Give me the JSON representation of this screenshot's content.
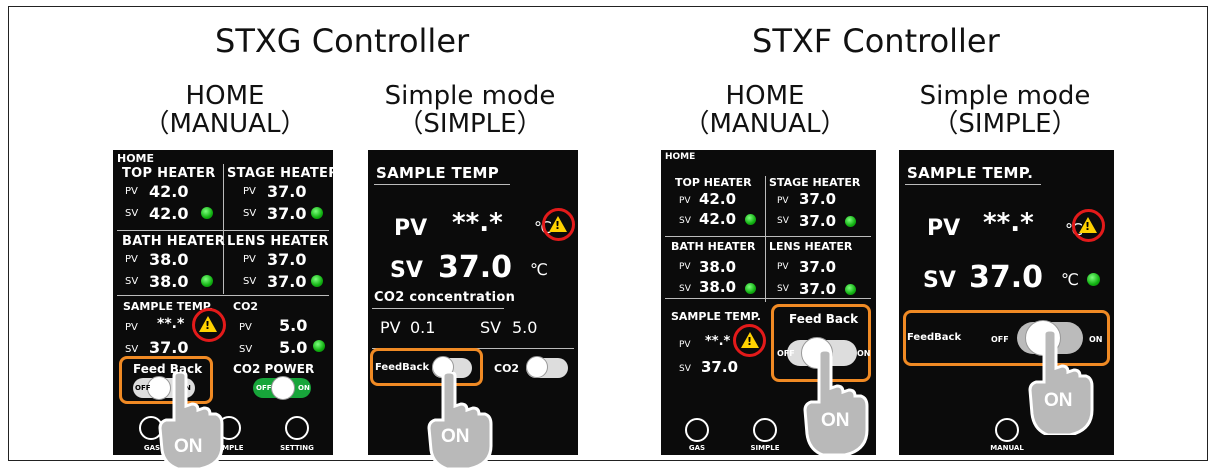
{
  "titles": {
    "stxg": "STXG Controller",
    "stxf": "STXF Controller"
  },
  "captions": {
    "home_line1": "HOME",
    "home_line2": "（MANUAL）",
    "simple_line1": "Simple mode",
    "simple_line2": "（SIMPLE）"
  },
  "stxg_home": {
    "home": "HOME",
    "top_heater": {
      "label": "TOP HEATER",
      "pv": "42.0",
      "sv": "42.0"
    },
    "stage_heater": {
      "label": "STAGE HEATER",
      "pv": "37.0",
      "sv": "37.0"
    },
    "bath_heater": {
      "label": "BATH HEATER",
      "pv": "38.0",
      "sv": "38.0"
    },
    "lens_heater": {
      "label": "LENS HEATER",
      "pv": "37.0",
      "sv": "37.0"
    },
    "sample_temp": {
      "label": "SAMPLE TEMP.",
      "pv": "**.*",
      "sv": "37.0"
    },
    "co2": {
      "label": "CO2",
      "pv": "5.0",
      "sv": "5.0"
    },
    "pv": "PV",
    "sv": "SV",
    "feedback": "Feed Back",
    "co2_power": "CO2 POWER",
    "off": "OFF",
    "on": "ON",
    "nav": {
      "gas": "GAS",
      "simple": "SIMPLE",
      "setting": "SETTING"
    }
  },
  "stxg_simple": {
    "header": "SAMPLE TEMP",
    "pv_label": "PV",
    "pv_value": "**.*",
    "sv_label": "SV",
    "sv_value": "37.0",
    "unit": "℃",
    "co2_header": "CO2 concentration",
    "co2_pv_label": "PV",
    "co2_pv": "0.1",
    "co2_sv_label": "SV",
    "co2_sv": "5.0",
    "feedback": "FeedBack",
    "co2": "CO2"
  },
  "stxf_home": {
    "home": "HOME",
    "top_heater": {
      "label": "TOP HEATER",
      "pv": "42.0",
      "sv": "42.0"
    },
    "stage_heater": {
      "label": "STAGE HEATER",
      "pv": "37.0",
      "sv": "37.0"
    },
    "bath_heater": {
      "label": "BATH HEATER",
      "pv": "38.0",
      "sv": "38.0"
    },
    "lens_heater": {
      "label": "LENS HEATER",
      "pv": "37.0",
      "sv": "37.0"
    },
    "sample_temp": {
      "label": "SAMPLE TEMP.",
      "pv": "**.*",
      "sv": "37.0"
    },
    "pv": "PV",
    "sv": "SV",
    "feedback": "Feed Back",
    "off": "OFF",
    "on": "ON",
    "nav": {
      "gas": "GAS",
      "simple": "SIMPLE"
    }
  },
  "stxf_simple": {
    "header": "SAMPLE TEMP.",
    "pv_label": "PV",
    "pv_value": "**.*",
    "sv_label": "SV",
    "sv_value": "37.0",
    "unit": "℃",
    "feedback": "FeedBack",
    "off": "OFF",
    "on": "ON",
    "nav": {
      "manual": "MANUAL"
    }
  },
  "callout": {
    "on": "ON"
  },
  "colors": {
    "ring": "#e31a1a",
    "highlight": "#f08a24",
    "led": "#10b010",
    "warning": "#ffd200"
  }
}
